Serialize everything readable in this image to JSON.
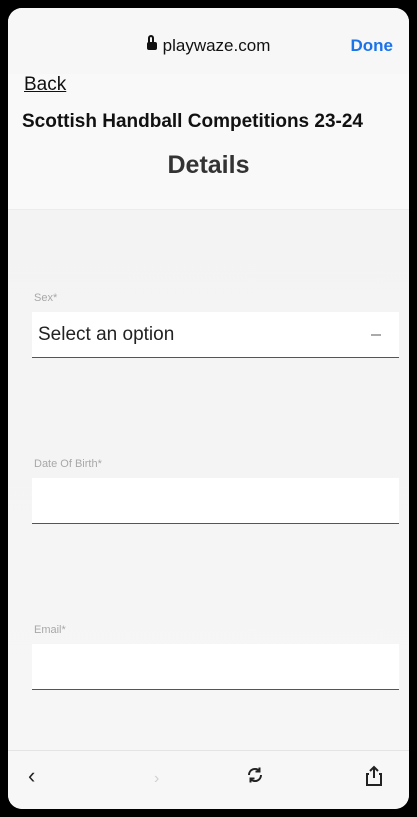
{
  "browser": {
    "url": "playwaze.com",
    "done_label": "Done"
  },
  "header": {
    "back_label": "Back",
    "competition_title": "Scottish Handball Competitions 23-24",
    "section_title": "Details"
  },
  "form": {
    "fields": [
      {
        "label": "Sex*",
        "type": "select",
        "value": "Select an option"
      },
      {
        "label": "Date Of Birth*",
        "type": "text",
        "value": ""
      },
      {
        "label": "Email*",
        "type": "text",
        "value": ""
      }
    ]
  },
  "toolbar": {
    "back_icon": "chevron-left-icon",
    "forward_icon": "chevron-right-icon",
    "reload_icon": "reload-icon",
    "share_icon": "share-icon"
  },
  "colors": {
    "accent": "#1a73e8",
    "background": "#f2f2f2"
  }
}
